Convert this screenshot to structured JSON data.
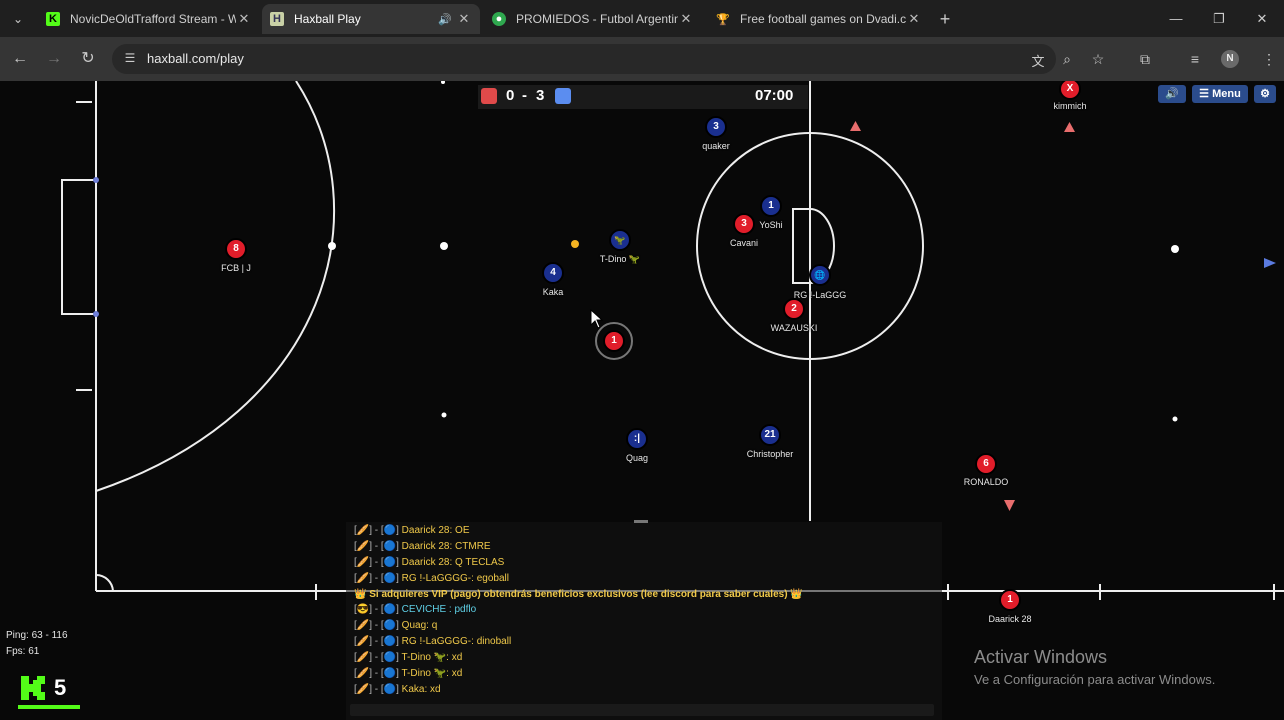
{
  "browser": {
    "tabs": [
      {
        "title": "NovicDeOldTrafford Stream - W",
        "active": false
      },
      {
        "title": "Haxball Play",
        "active": true
      },
      {
        "title": "PROMIEDOS - Futbol Argentino",
        "active": false
      },
      {
        "title": "Free football games on Dvadi.c",
        "active": false
      }
    ],
    "url": "haxball.com/play",
    "profile_initial": "N"
  },
  "game": {
    "score": {
      "red": "0",
      "sep": "-",
      "blue": "3",
      "time": "07:00"
    },
    "menu_label": "Menu",
    "players": [
      {
        "team": "blue",
        "number": "3",
        "name": "quaker"
      },
      {
        "team": "red",
        "number": "X",
        "name": "kimmich"
      },
      {
        "team": "red",
        "number": "8",
        "name": "FCB | J"
      },
      {
        "team": "blue",
        "number": "1",
        "name": "YoShi"
      },
      {
        "team": "red",
        "number": "3",
        "name": "Cavani"
      },
      {
        "team": "blue",
        "number": "🦖",
        "name": "T-Dino 🦖"
      },
      {
        "team": "blue",
        "number": "4",
        "name": "Kaka"
      },
      {
        "team": "blue",
        "number": "🌐",
        "name": "RG !-LaGGG"
      },
      {
        "team": "red",
        "number": "2",
        "name": "WAZAUSKI"
      },
      {
        "team": "red",
        "number": "1",
        "name": ""
      },
      {
        "team": "blue",
        "number": ":|",
        "name": "Quag"
      },
      {
        "team": "blue",
        "number": "21",
        "name": "Christopher"
      },
      {
        "team": "red",
        "number": "6",
        "name": "RONALDO"
      },
      {
        "team": "red",
        "number": "1",
        "name": "Daarick 28"
      }
    ],
    "chat": [
      {
        "prefix": "[🥖] - [🔵]",
        "text": " Daarick 28: OE",
        "color": "#f0c94a"
      },
      {
        "prefix": "[🥖] - [🔵]",
        "text": " Daarick 28: CTMRE",
        "color": "#f0c94a"
      },
      {
        "prefix": "[🥖] - [🔵]",
        "text": " Daarick 28: Q TECLAS",
        "color": "#f0c94a"
      },
      {
        "prefix": "[🥖] - [🔵]",
        "text": " RG !-LaGGGG-: egoball",
        "color": "#f0c94a"
      },
      {
        "prefix": "👑",
        "text": " Si adquieres VIP (pago) obtendrás beneficios exclusivos (lee discord para saber cuales) 👑",
        "color": "#f0c94a"
      },
      {
        "prefix": "[😎] - [🔵]",
        "text": " CEVICHE : pdflo",
        "color": "#5fd0e6"
      },
      {
        "prefix": "[🥖] - [🔵]",
        "text": " Quag: q",
        "color": "#f0c94a"
      },
      {
        "prefix": "[🥖] - [🔵]",
        "text": " RG !-LaGGGG-: dinoball",
        "color": "#f0c94a"
      },
      {
        "prefix": "[🥖] - [🔵]",
        "text": " T-Dino 🦖: xd",
        "color": "#f0c94a"
      },
      {
        "prefix": "[🥖] - [🔵]",
        "text": " T-Dino 🦖: xd",
        "color": "#f0c94a"
      },
      {
        "prefix": "[🥖] - [🔵]",
        "text": " Kaka: xd",
        "color": "#f0c94a"
      }
    ],
    "stats": {
      "ping": "Ping: 63 - 116",
      "fps": "Fps: 61"
    }
  },
  "overlay": {
    "kick_value": "5",
    "watermark_title": "Activar Windows",
    "watermark_sub": "Ve a Configuración para activar Windows."
  },
  "colors": {
    "red_team": "#e11d2a",
    "blue_team": "#1a2f8f",
    "blue_score": "#5b8df0",
    "red_score": "#e04a4a",
    "kick_green": "#53fc18"
  }
}
